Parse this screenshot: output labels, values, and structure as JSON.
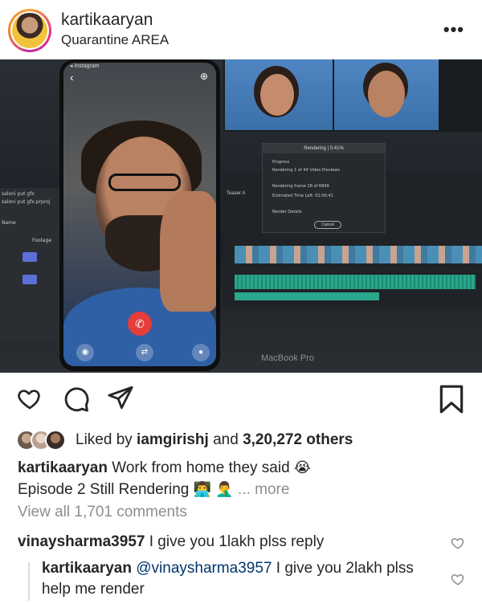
{
  "post": {
    "username": "kartikaaryan",
    "location": "Quarantine AREA",
    "more_label": "•••"
  },
  "photo": {
    "app_label": "◂ Instagram",
    "render_dialog": {
      "title": "Rendering | 0.41%",
      "lines": [
        "Progress",
        "Rendering 1 of 44 Video Previews",
        "Rendering frame 28 of 6849",
        "Estimated Time Left: 01:06:41",
        "Render Details"
      ],
      "cancel": "Cancel"
    },
    "project_labels": [
      "saloni put gfx",
      "saloni put gfx.prproj",
      "Name",
      "Footage"
    ],
    "sequence_label": "Teaser A",
    "laptop_brand": "MacBook Pro"
  },
  "likes": {
    "prefix": "Liked by ",
    "user": "iamgirishj",
    "middle": " and ",
    "count": "3,20,272 others"
  },
  "caption": {
    "user": "kartikaaryan",
    "text_line1": " Work from home they said ",
    "emoji1": "😭",
    "text_line2": "Episode 2 Still Rendering ",
    "emoji2": "👨‍💻",
    "emoji3": "🤦‍♂️",
    "more": "... more"
  },
  "view_all": "View all 1,701 comments",
  "comments": [
    {
      "user": "vinaysharma3957",
      "text": " I give you 1lakh plss reply"
    },
    {
      "user": "kartikaaryan",
      "mention": " @vinaysharma3957",
      "text": " I give you 2lakh plss help me render"
    }
  ],
  "colors": {
    "text": "#262626",
    "muted": "#8e8e8e",
    "mention": "#00376b",
    "divider": "#dbdbdb"
  }
}
